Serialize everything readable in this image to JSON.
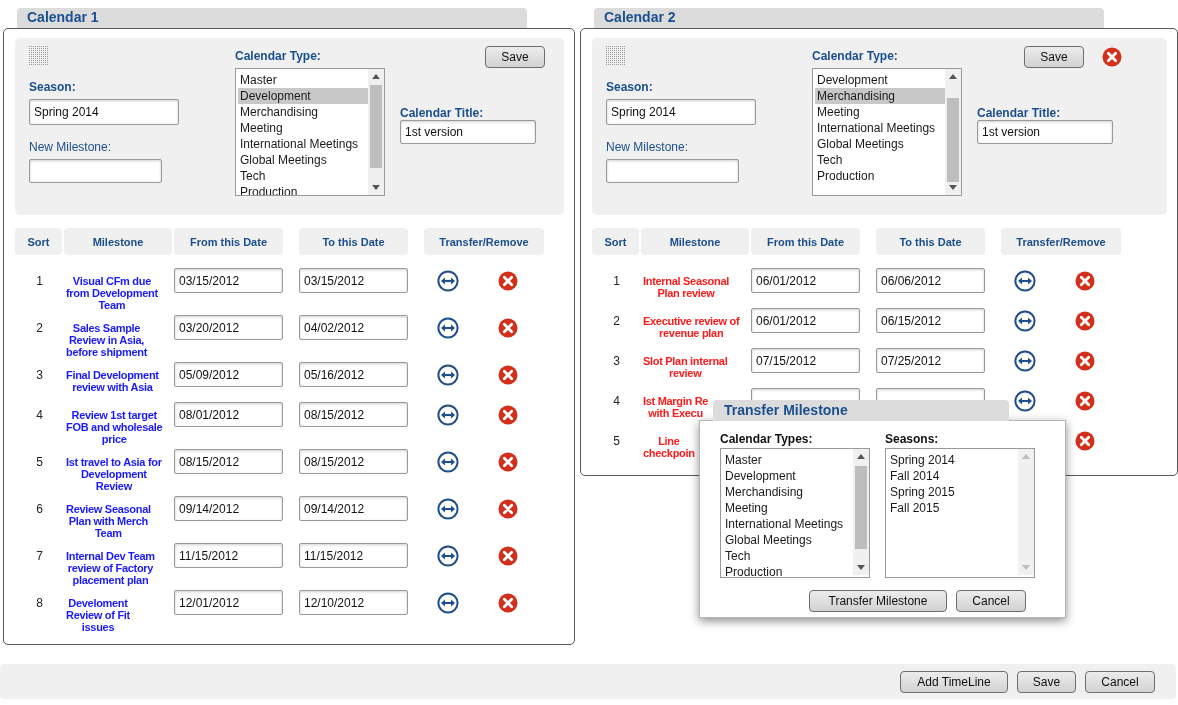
{
  "calendars": [
    {
      "title": "Calendar 1",
      "color": "#1a1aff",
      "removable": false,
      "season_label": "Season:",
      "season": "Spring 2014",
      "new_milestone_label": "New Milestone:",
      "type_label": "Calendar Type:",
      "types": [
        {
          "label": "Master",
          "selected": false
        },
        {
          "label": "Development",
          "selected": true
        },
        {
          "label": "Merchandising",
          "selected": false
        },
        {
          "label": "Meeting",
          "selected": false
        },
        {
          "label": "International Meetings",
          "selected": false
        },
        {
          "label": "Global Meetings",
          "selected": false
        },
        {
          "label": "Tech",
          "selected": false
        },
        {
          "label": "Production",
          "selected": false
        }
      ],
      "title_label": "Calendar Title:",
      "calendar_title": "1st version",
      "save": "Save",
      "columns": [
        "Sort",
        "Milestone",
        "From this Date",
        "To this Date",
        "Transfer/Remove"
      ],
      "rows": [
        {
          "kind": "full",
          "sort": "1",
          "milestone": "Visual CFm due\nfrom Development\nTeam",
          "from": "03/15/2012",
          "to": "03/15/2012"
        },
        {
          "kind": "full",
          "sort": "2",
          "milestone": "Sales Sample\nReview in Asia,\nbefore shipment",
          "from": "03/20/2012",
          "to": "04/02/2012"
        },
        {
          "kind": "full",
          "sort": "3",
          "milestone": "Final Development\nreview with Asia",
          "from": "05/09/2012",
          "to": "05/16/2012"
        },
        {
          "kind": "full",
          "sort": "4",
          "milestone": "Review 1st target\nFOB and wholesale\nprice",
          "from": "08/01/2012",
          "to": "08/15/2012"
        },
        {
          "kind": "full",
          "sort": "5",
          "milestone": "Ist travel to Asia for\nDevelopment\nReview",
          "from": "08/15/2012",
          "to": "08/15/2012"
        },
        {
          "kind": "full",
          "sort": "6",
          "milestone": "Review Seasonal\nPlan with Merch\nTeam",
          "from": "09/14/2012",
          "to": "09/14/2012"
        },
        {
          "kind": "full",
          "sort": "7",
          "milestone": "Internal Dev Team\nreview of Factory\nplacement plan",
          "from": "11/15/2012",
          "to": "11/15/2012"
        },
        {
          "kind": "full",
          "sort": "8",
          "milestone": "Develoment\nReview of Fit\nissues",
          "from": "12/01/2012",
          "to": "12/10/2012"
        }
      ]
    },
    {
      "title": "Calendar 2",
      "color": "#ff1a1a",
      "removable": true,
      "season_label": "Season:",
      "season": "Spring 2014",
      "new_milestone_label": "New Milestone:",
      "type_label": "Calendar Type:",
      "types": [
        {
          "label": "Development",
          "selected": false
        },
        {
          "label": "Merchandising",
          "selected": true
        },
        {
          "label": "Meeting",
          "selected": false
        },
        {
          "label": "International Meetings",
          "selected": false
        },
        {
          "label": "Global Meetings",
          "selected": false
        },
        {
          "label": "Tech",
          "selected": false
        },
        {
          "label": "Production",
          "selected": false
        }
      ],
      "title_label": "Calendar Title:",
      "calendar_title": "1st version",
      "save": "Save",
      "columns": [
        "Sort",
        "Milestone",
        "From this Date",
        "To this Date",
        "Transfer/Remove"
      ],
      "rows": [
        {
          "kind": "full",
          "sort": "1",
          "milestone": "Internal Seasonal\nPlan review",
          "from": "06/01/2012",
          "to": "06/06/2012"
        },
        {
          "kind": "full",
          "sort": "2",
          "milestone": "Executive review of\nrevenue plan",
          "from": "06/01/2012",
          "to": "06/15/2012"
        },
        {
          "kind": "full",
          "sort": "3",
          "milestone": "Slot Plan internal\nreview",
          "from": "07/15/2012",
          "to": "07/25/2012"
        },
        {
          "kind": "fields",
          "sort": "4",
          "milestone": "Ist Margin Re\nwith Execu"
        },
        {
          "kind": "remove",
          "sort": "5",
          "milestone": "Line\ncheckpoin"
        }
      ]
    }
  ],
  "dialog": {
    "title": "Transfer Milestone",
    "types_label": "Calendar Types:",
    "types": [
      {
        "label": "Master",
        "selected": false
      },
      {
        "label": "Development",
        "selected": false
      },
      {
        "label": "Merchandising",
        "selected": false
      },
      {
        "label": "Meeting",
        "selected": false
      },
      {
        "label": "International Meetings",
        "selected": false
      },
      {
        "label": "Global Meetings",
        "selected": false
      },
      {
        "label": "Tech",
        "selected": false
      },
      {
        "label": "Production",
        "selected": false
      }
    ],
    "seasons_label": "Seasons:",
    "seasons": [
      {
        "label": "Spring 2014",
        "selected": false
      },
      {
        "label": "Fall 2014",
        "selected": false
      },
      {
        "label": "Spring 2015",
        "selected": false
      },
      {
        "label": "Fall 2015",
        "selected": false
      }
    ],
    "buttons": [
      "Transfer Milestone",
      "Cancel"
    ]
  },
  "footer_buttons": [
    "Add TimeLine",
    "Save",
    "Cancel"
  ]
}
